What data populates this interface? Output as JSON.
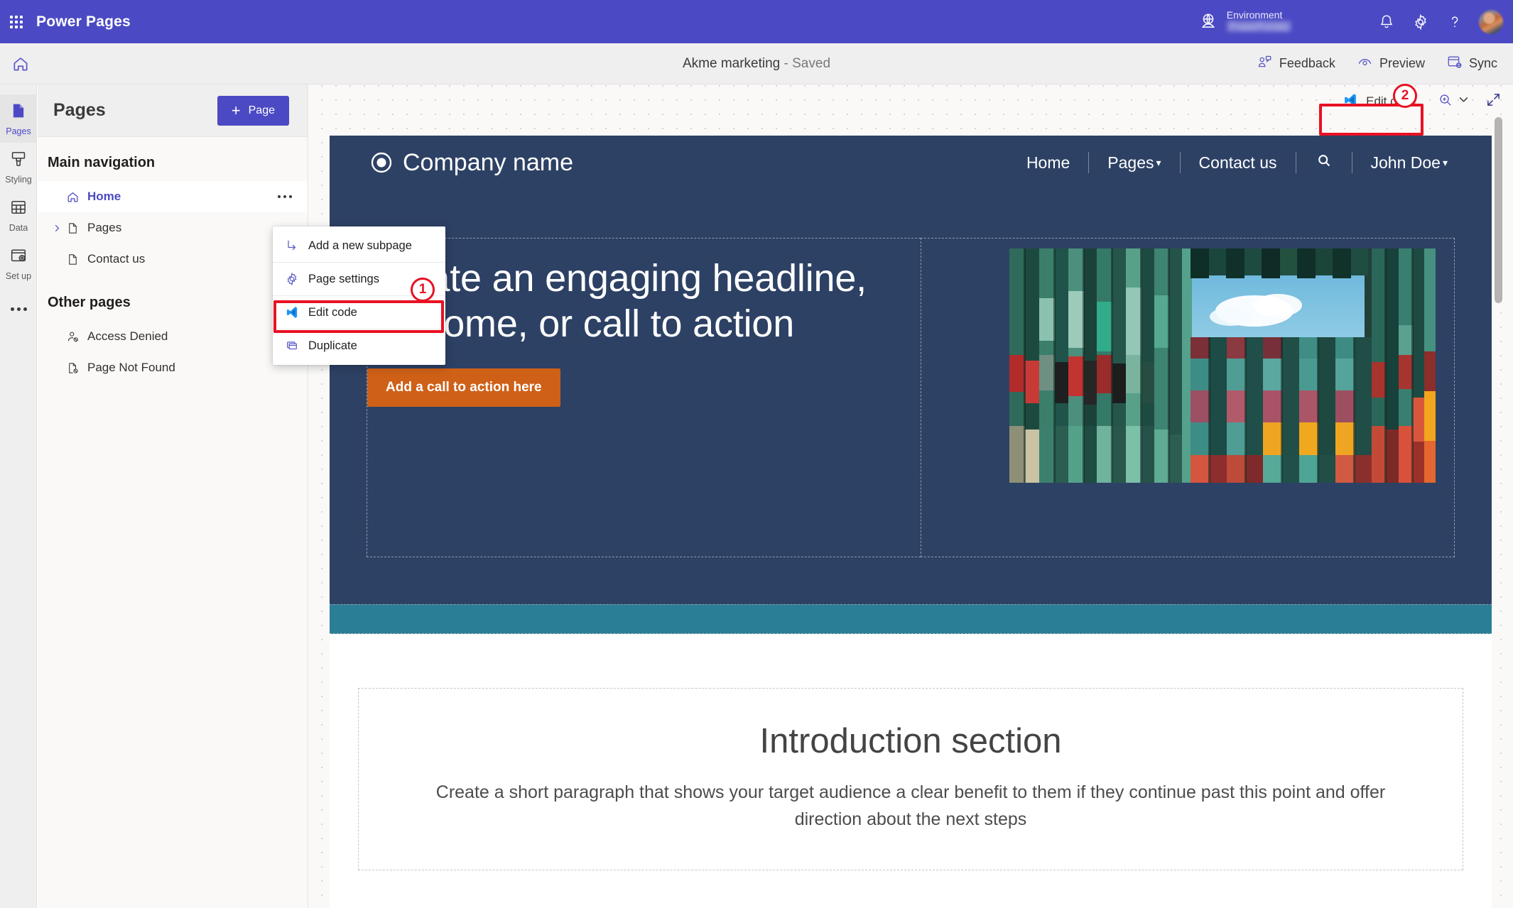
{
  "suite": {
    "waffle_icon": "waffle-grid-icon",
    "title": "Power Pages",
    "environment_label": "Environment",
    "environment_value": "PowerPortals",
    "globe_icon": "environment-globe-icon",
    "notifications_icon": "bell-icon",
    "settings_icon": "gear-icon",
    "help_icon": "question-mark-icon",
    "avatar": "user-avatar",
    "bar_color": "#4b4ac4"
  },
  "command_bar": {
    "home_icon": "home-icon",
    "doc_title": "Akme marketing",
    "doc_status": " - Saved",
    "feedback_label": "Feedback",
    "preview_label": "Preview",
    "sync_label": "Sync"
  },
  "rail": {
    "items": [
      {
        "label": "Pages",
        "icon": "page-file-icon",
        "active": true
      },
      {
        "label": "Styling",
        "icon": "paint-brush-icon",
        "active": false
      },
      {
        "label": "Data",
        "icon": "table-grid-icon",
        "active": false
      },
      {
        "label": "Set up",
        "icon": "setup-gear-window-icon",
        "active": false
      }
    ],
    "more_label": "more-options-ellipsis"
  },
  "panel": {
    "title": "Pages",
    "add_button_label": "Page",
    "add_button_plus": "+",
    "main_nav_group": "Main navigation",
    "other_group": "Other pages",
    "main_items": [
      {
        "label": "Home",
        "icon": "home-outline-icon",
        "selected": true,
        "has_chevron": false,
        "has_ellipsis": true
      },
      {
        "label": "Pages",
        "icon": "page-outline-icon",
        "selected": false,
        "has_chevron": true,
        "has_ellipsis": false
      },
      {
        "label": "Contact us",
        "icon": "page-outline-icon",
        "selected": false,
        "has_chevron": false,
        "has_ellipsis": false
      }
    ],
    "other_items": [
      {
        "label": "Access Denied",
        "icon": "person-blocked-icon"
      },
      {
        "label": "Page Not Found",
        "icon": "page-blocked-icon"
      }
    ]
  },
  "context_menu": {
    "items": [
      {
        "label": "Add a new subpage",
        "icon": "subpage-arrow-icon",
        "highlighted": false
      },
      {
        "label": "Page settings",
        "icon": "gear-icon",
        "highlighted": false
      },
      {
        "label": "Edit code",
        "icon": "vscode-icon",
        "highlighted": true
      },
      {
        "label": "Duplicate",
        "icon": "duplicate-windows-icon",
        "highlighted": false
      }
    ]
  },
  "canvas_toolbar": {
    "edit_code_label": "Edit code",
    "edit_code_icon": "vscode-icon",
    "zoom_icon": "zoom-in-magnifier-icon",
    "zoom_chevron": "chevron-down-icon",
    "expand_icon": "expand-diagonal-arrows-icon"
  },
  "site_preview": {
    "brand_name": "Company name",
    "brand_logo": "circle-logo-icon",
    "nav": [
      {
        "label": "Home",
        "caret": false
      },
      {
        "label": "Pages",
        "caret": true
      },
      {
        "label": "Contact us",
        "caret": false
      },
      {
        "label": "",
        "caret": false,
        "icon": "search-icon"
      },
      {
        "label": "John Doe",
        "caret": true
      }
    ],
    "hero_headline": "Create an engaging headline, welcome, or call to action",
    "hero_cta_label": "Add a call to action here",
    "hero_image_alt": "shipping-containers-looking-up-at-sky",
    "intro_heading": "Introduction section",
    "intro_paragraph": "Create a short paragraph that shows your target audience a clear benefit to them if they continue past this point and offer direction about the next steps",
    "colors": {
      "nav_bg": "#2d4164",
      "hero_bg": "#2d4164",
      "cta_bg": "#cf6017",
      "band_bg": "#2a7f96"
    }
  },
  "annotations": {
    "step1": "1",
    "step2": "2",
    "highlight_color": "#e81123"
  }
}
